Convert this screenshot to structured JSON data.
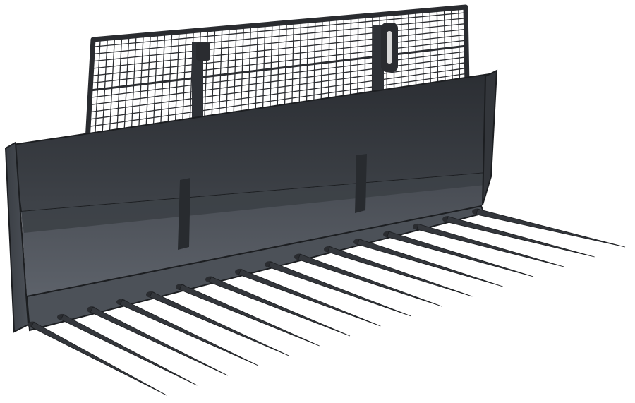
{
  "subject": {
    "name": "manure-fork-bucket",
    "tine_count": 16,
    "has_mesh_guard": true
  },
  "colors": {
    "background": "#ffffff",
    "steel_dark": "#2f3237",
    "steel_mid": "#3c4046",
    "steel_light": "#53585f",
    "steel_edge": "#1c1e21",
    "floor_plate": "#5a5f66",
    "mesh": "#2a2c30",
    "tine": "#34373c"
  }
}
